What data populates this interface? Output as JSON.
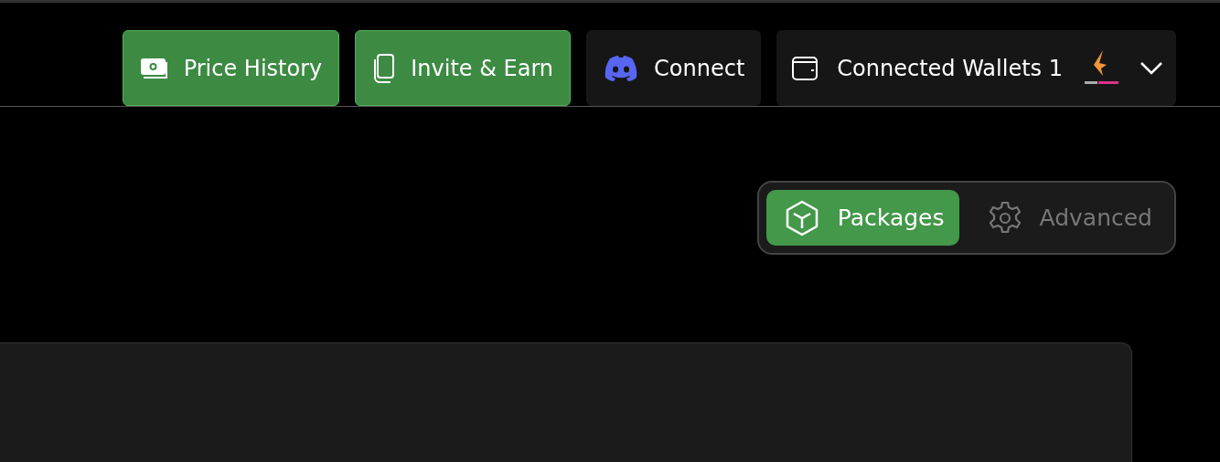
{
  "header": {
    "buttons": [
      {
        "label": "Price History",
        "kind": "money"
      },
      {
        "label": "Invite & Earn",
        "kind": "copy"
      },
      {
        "label": "Connect",
        "kind": "discord"
      }
    ],
    "wallet": {
      "label": "Connected Wallets 1"
    }
  },
  "tabs": [
    {
      "label": "Packages",
      "kind": "box",
      "selected": true
    },
    {
      "label": "Advanced",
      "kind": "gear",
      "selected": false
    }
  ]
}
